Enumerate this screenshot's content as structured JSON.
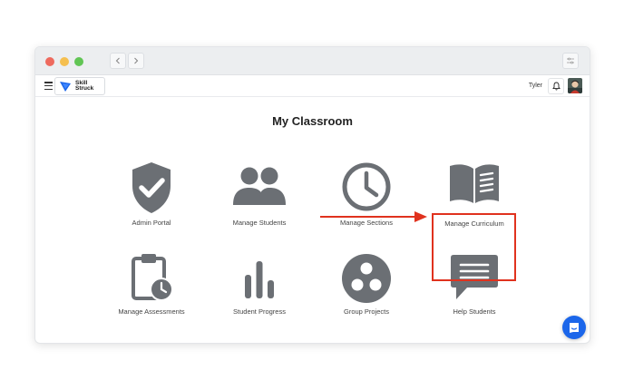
{
  "header": {
    "brand_line1": "Skill",
    "brand_line2": "Struck",
    "username": "Tyler"
  },
  "main": {
    "title": "My Classroom",
    "tiles": [
      {
        "label": "Admin Portal",
        "icon": "shield-check-icon"
      },
      {
        "label": "Manage Students",
        "icon": "users-icon"
      },
      {
        "label": "Manage Sections",
        "icon": "clock-icon"
      },
      {
        "label": "Manage Curriculum",
        "icon": "open-book-icon"
      },
      {
        "label": "Manage Assessments",
        "icon": "clipboard-clock-icon"
      },
      {
        "label": "Student Progress",
        "icon": "bar-chart-icon"
      },
      {
        "label": "Group Projects",
        "icon": "group-circle-icon"
      },
      {
        "label": "Help Students",
        "icon": "chat-bubble-icon"
      }
    ]
  },
  "colors": {
    "icon_gray": "#6b6f74",
    "highlight_red": "#e0321e",
    "brand_blue": "#1b66ea"
  }
}
